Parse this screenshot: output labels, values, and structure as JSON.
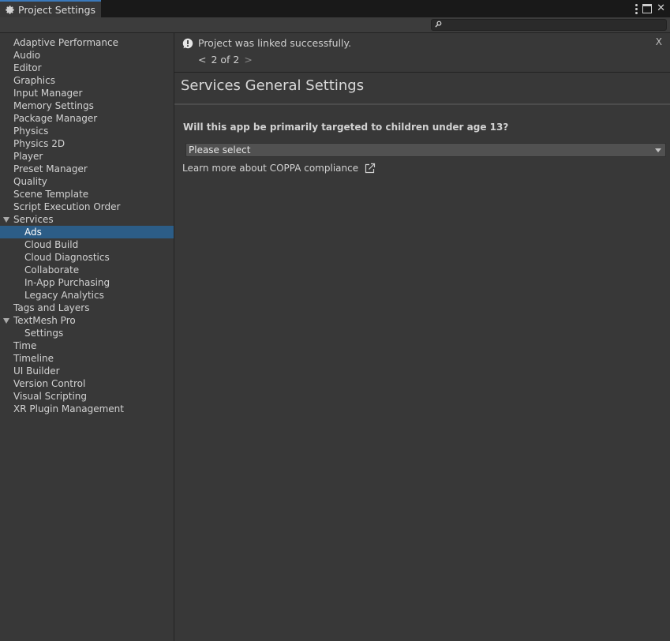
{
  "window": {
    "tab_title": "Project Settings"
  },
  "search": {
    "placeholder": "",
    "value": ""
  },
  "sidebar": {
    "items": [
      {
        "label": "Adaptive Performance",
        "level": 0
      },
      {
        "label": "Audio",
        "level": 0
      },
      {
        "label": "Editor",
        "level": 0
      },
      {
        "label": "Graphics",
        "level": 0
      },
      {
        "label": "Input Manager",
        "level": 0
      },
      {
        "label": "Memory Settings",
        "level": 0
      },
      {
        "label": "Package Manager",
        "level": 0
      },
      {
        "label": "Physics",
        "level": 0
      },
      {
        "label": "Physics 2D",
        "level": 0
      },
      {
        "label": "Player",
        "level": 0
      },
      {
        "label": "Preset Manager",
        "level": 0
      },
      {
        "label": "Quality",
        "level": 0
      },
      {
        "label": "Scene Template",
        "level": 0
      },
      {
        "label": "Script Execution Order",
        "level": 0
      },
      {
        "label": "Services",
        "level": 0,
        "expanded": true
      },
      {
        "label": "Ads",
        "level": 1,
        "selected": true
      },
      {
        "label": "Cloud Build",
        "level": 1
      },
      {
        "label": "Cloud Diagnostics",
        "level": 1
      },
      {
        "label": "Collaborate",
        "level": 1
      },
      {
        "label": "In-App Purchasing",
        "level": 1
      },
      {
        "label": "Legacy Analytics",
        "level": 1
      },
      {
        "label": "Tags and Layers",
        "level": 0
      },
      {
        "label": "TextMesh Pro",
        "level": 0,
        "expanded": true
      },
      {
        "label": "Settings",
        "level": 1
      },
      {
        "label": "Time",
        "level": 0
      },
      {
        "label": "Timeline",
        "level": 0
      },
      {
        "label": "UI Builder",
        "level": 0
      },
      {
        "label": "Version Control",
        "level": 0
      },
      {
        "label": "Visual Scripting",
        "level": 0
      },
      {
        "label": "XR Plugin Management",
        "level": 0
      }
    ]
  },
  "notification": {
    "message": "Project was linked successfully.",
    "close_label": "X",
    "pager": {
      "prev": "<",
      "text": "2 of 2",
      "next": ">"
    }
  },
  "main": {
    "section_title": "Services General Settings",
    "question": "Will this app be primarily targeted to children under age 13?",
    "dropdown_value": "Please select",
    "learn_more": "Learn more about COPPA compliance"
  },
  "colors": {
    "selection": "#2c5d87",
    "tab_accent": "#3a79bb",
    "background": "#383838"
  }
}
